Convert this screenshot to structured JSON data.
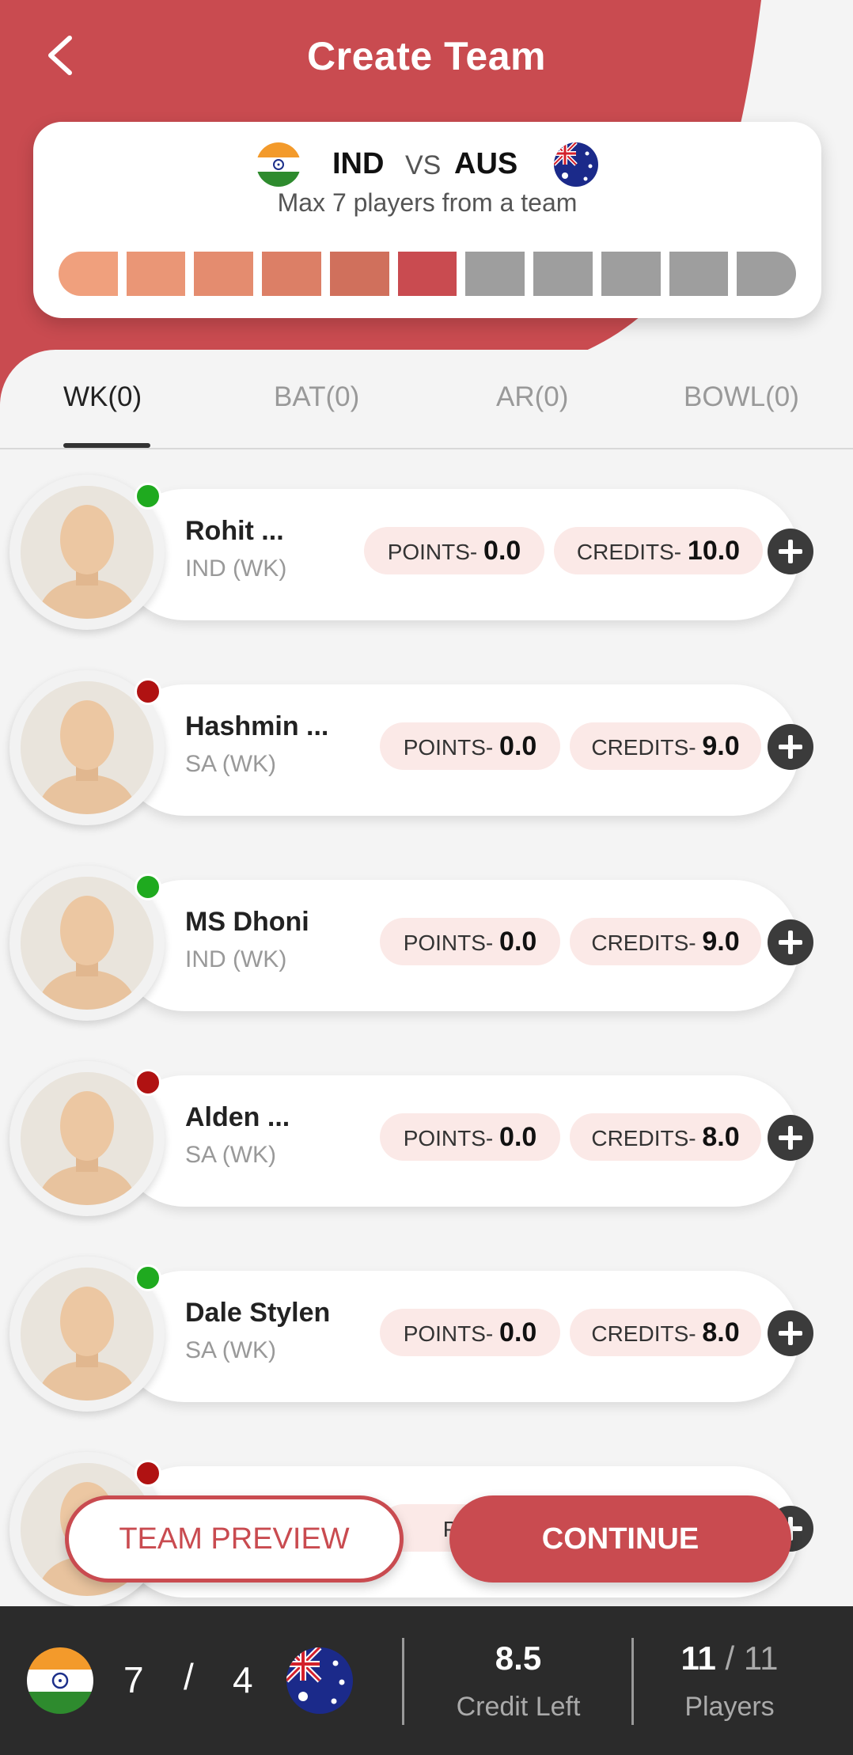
{
  "header": {
    "title": "Create Team",
    "back_icon": "chevron-left-icon",
    "brand_color": "#c94b50"
  },
  "match": {
    "team_a": "IND",
    "vs": "VS",
    "team_b": "AUS",
    "team_a_flag": "india-flag-icon",
    "team_b_flag": "australia-flag-icon",
    "max_text": "Max 7 players from a team",
    "progress": {
      "filled": 6,
      "total": 11,
      "filled_colors": [
        "#f0a07d",
        "#ea9676",
        "#e48c6f",
        "#dc7f66",
        "#d0705c",
        "#c94b50"
      ],
      "empty_color": "#9e9e9e"
    }
  },
  "tabs": [
    {
      "label": "WK(0)",
      "active": true
    },
    {
      "label": "BAT(0)",
      "active": false
    },
    {
      "label": "AR(0)",
      "active": false
    },
    {
      "label": "BOWL(0)",
      "active": false
    }
  ],
  "players": [
    {
      "name": "Rohit ...",
      "role": "IND (WK)",
      "points_label": "POINTS-",
      "points": "0.0",
      "credits_label": "CREDITS-",
      "credits": "10.0",
      "status_color": "#1faa1f"
    },
    {
      "name": "Hashmin ...",
      "role": "SA (WK)",
      "points_label": "POINTS-",
      "points": "0.0",
      "credits_label": "CREDITS-",
      "credits": "9.0",
      "status_color": "#b01212"
    },
    {
      "name": "MS Dhoni",
      "role": "IND (WK)",
      "points_label": "POINTS-",
      "points": "0.0",
      "credits_label": "CREDITS-",
      "credits": "9.0",
      "status_color": "#1faa1f"
    },
    {
      "name": "Alden ...",
      "role": "SA (WK)",
      "points_label": "POINTS-",
      "points": "0.0",
      "credits_label": "CREDITS-",
      "credits": "8.0",
      "status_color": "#b01212"
    },
    {
      "name": "Dale Stylen",
      "role": "SA (WK)",
      "points_label": "POINTS-",
      "points": "0.0",
      "credits_label": "CREDITS-",
      "credits": "8.0",
      "status_color": "#1faa1f"
    },
    {
      "name": "",
      "role": "",
      "points_label": "POIN",
      "points": "",
      "credits_label": "",
      "credits": "",
      "status_color": "#b01212"
    }
  ],
  "actions": {
    "preview_label": "TEAM PREVIEW",
    "continue_label": "CONTINUE"
  },
  "footer": {
    "team_a_count": "7",
    "slash": "/",
    "team_b_count": "4",
    "credit_left_value": "8.5",
    "credit_left_label": "Credit Left",
    "players_selected": "11",
    "players_sep": " / ",
    "players_total": "11",
    "players_label": "Players"
  }
}
